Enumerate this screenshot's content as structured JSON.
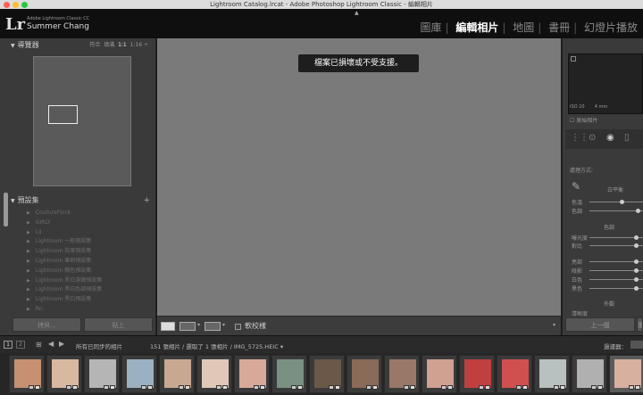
{
  "window": {
    "title": "Lightroom Catalog.lrcat - Adobe Photoshop Lightroom Classic - 編輯相片"
  },
  "identity": {
    "logo": "Lr",
    "product": "Adobe Lightroom Classic CC",
    "user": "Summer Chang"
  },
  "modules": {
    "items": [
      "圖庫",
      "編輯相片",
      "地圖",
      "書冊",
      "幻燈片播放"
    ],
    "active": "編輯相片"
  },
  "navigator": {
    "title": "導覽器",
    "zoom_fit": "符合",
    "zoom_fill": "填滿",
    "zoom_1": "1:1",
    "zoom_custom": "1:16 ÷"
  },
  "presets": {
    "title": "預設集",
    "items": [
      "CoutureFlock",
      "GIRLY",
      "Lil",
      "Lightroom 一般預設集",
      "Lightroom 效果預設集",
      "Lightroom 筆刷預設集",
      "Lightroom 顏色預設集",
      "Lightroom 黑白濾鏡預設集",
      "Lightroom 黑白色調預設集",
      "Lightroom 黑白預設集",
      "Rn"
    ]
  },
  "left_buttons": {
    "copy": "拷貝...",
    "paste": "貼上"
  },
  "center": {
    "toast": "檔案已損壞或不受支援。"
  },
  "toolbar": {
    "soft_proof_label": "軟校樣"
  },
  "right_panel": {
    "histo_iso": "ISO 20",
    "histo_focal": "4 mm",
    "original_photo": "原始相片",
    "treatment": "處理方式:",
    "wb": "白平衡",
    "temp": "色溫",
    "tint": "色調",
    "tone": "色調",
    "exposure": "曝光度",
    "contrast": "對比",
    "highlights": "亮部",
    "shadows": "陰影",
    "whites": "白色",
    "blacks": "黑色",
    "presence": "外觀",
    "clarity": "清晰度",
    "prev_btn": "上一個",
    "reset_btn": "重設"
  },
  "filmbar": {
    "page1": "1",
    "page2": "2",
    "source": "所有已同步的相片",
    "status": "151 張相片 / 選取了 1 張相片 / IMG_5725.HEIC ▾",
    "filter": "過濾器："
  },
  "colors": {
    "accent": "#ffffff",
    "panel": "#3a3a3a",
    "canvas": "#7a7a7a"
  },
  "filmstrip": {
    "thumbnails": [
      {
        "tone": "#c79070"
      },
      {
        "tone": "#d9b8a0"
      },
      {
        "tone": "#b5b5b5"
      },
      {
        "tone": "#9bb0c0"
      },
      {
        "tone": "#c8a890"
      },
      {
        "tone": "#e0c8b8"
      },
      {
        "tone": "#d8a898"
      },
      {
        "tone": "#7a9080"
      },
      {
        "tone": "#6a5848"
      },
      {
        "tone": "#8a6a58"
      },
      {
        "tone": "#9a7868"
      },
      {
        "tone": "#d0a090"
      },
      {
        "tone": "#c04040"
      },
      {
        "tone": "#d05050"
      },
      {
        "tone": "#b8c0c0"
      },
      {
        "tone": "#b0b0b0"
      },
      {
        "tone": "#d8b0a0"
      },
      {
        "tone": "#c0c0c0"
      }
    ]
  }
}
